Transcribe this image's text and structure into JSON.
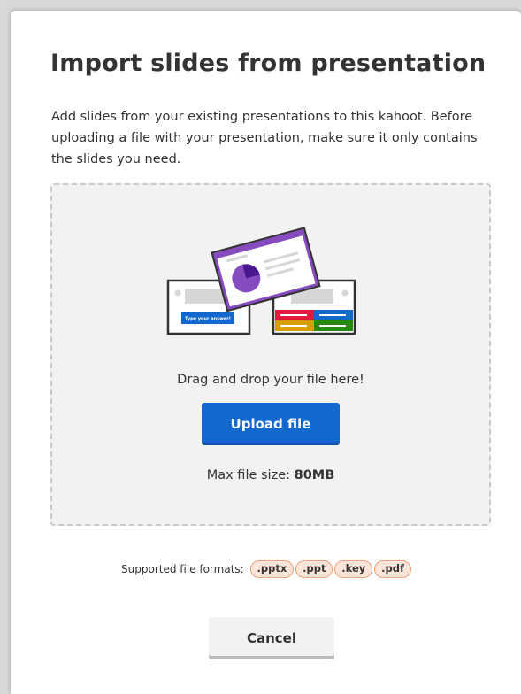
{
  "dialog": {
    "title": "Import slides from presentation",
    "description": "Add slides from your existing presentations to this kahoot. Before uploading a file with your presentation, make sure it only contains the slides you need."
  },
  "dropzone": {
    "illustration_answer_text": "Type your answer!",
    "drag_text": "Drag and drop your file here!",
    "upload_label": "Upload file",
    "max_size_label": "Max file size:",
    "max_size_value": "80MB"
  },
  "formats": {
    "label": "Supported file formats:",
    "items": [
      ".pptx",
      ".ppt",
      ".key",
      ".pdf"
    ]
  },
  "footer": {
    "cancel_label": "Cancel"
  },
  "colors": {
    "primary_button": "#1368ce",
    "purple_slide": "#864cbf",
    "pill_border": "#f0a07a",
    "pill_fill": "#fbe4d8",
    "answer_red": "#e21b3c",
    "answer_blue": "#1368ce",
    "answer_yellow": "#d89e00",
    "answer_green": "#26890c"
  }
}
